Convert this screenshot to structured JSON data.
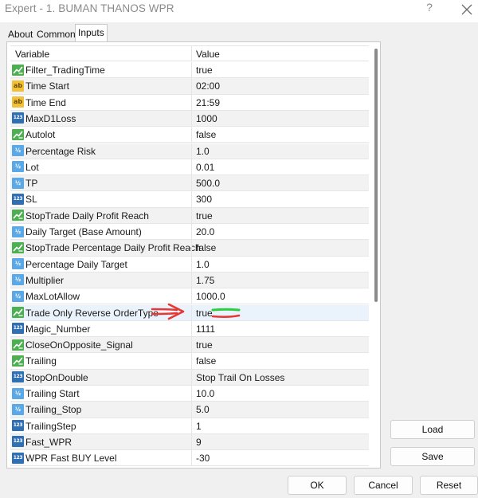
{
  "window": {
    "title": "Expert - 1. BUMAN THANOS WPR",
    "help_label": "?"
  },
  "tabs": [
    {
      "label": "About"
    },
    {
      "label": "Common"
    },
    {
      "label": "Inputs"
    }
  ],
  "grid": {
    "header": {
      "variable": "Variable",
      "value": "Value"
    },
    "rows": [
      {
        "icon": "bool-param-icon",
        "glyph": "",
        "name": "Filter_TradingTime",
        "value": "true"
      },
      {
        "icon": "string-param-icon",
        "glyph": "ab",
        "name": "Time Start",
        "value": "02:00"
      },
      {
        "icon": "string-param-icon",
        "glyph": "ab",
        "name": "Time End",
        "value": "21:59"
      },
      {
        "icon": "int-param-icon",
        "glyph": "123",
        "name": "MaxD1Loss",
        "value": "1000"
      },
      {
        "icon": "bool-param-icon",
        "glyph": "",
        "name": "Autolot",
        "value": "false"
      },
      {
        "icon": "double-param-icon",
        "glyph": "½",
        "name": "Percentage Risk",
        "value": "1.0"
      },
      {
        "icon": "double-param-icon",
        "glyph": "½",
        "name": "Lot",
        "value": "0.01"
      },
      {
        "icon": "double-param-icon",
        "glyph": "½",
        "name": "TP",
        "value": "500.0"
      },
      {
        "icon": "int-param-icon",
        "glyph": "123",
        "name": "SL",
        "value": "300"
      },
      {
        "icon": "bool-param-icon",
        "glyph": "",
        "name": "StopTrade Daily Profit Reach",
        "value": "true"
      },
      {
        "icon": "double-param-icon",
        "glyph": "½",
        "name": "Daily Target (Base Amount)",
        "value": "20.0"
      },
      {
        "icon": "bool-param-icon",
        "glyph": "",
        "name": "StopTrade Percentage Daily Profit Reach",
        "value": "false"
      },
      {
        "icon": "double-param-icon",
        "glyph": "½",
        "name": "Percentage Daily Target",
        "value": "1.0"
      },
      {
        "icon": "double-param-icon",
        "glyph": "½",
        "name": "Multiplier",
        "value": "1.75"
      },
      {
        "icon": "double-param-icon",
        "glyph": "½",
        "name": "MaxLotAllow",
        "value": "1000.0"
      },
      {
        "icon": "bool-param-icon",
        "glyph": "",
        "name": "Trade Only Reverse OrderType",
        "value": "true"
      },
      {
        "icon": "int-param-icon",
        "glyph": "123",
        "name": "Magic_Number",
        "value": "1111"
      },
      {
        "icon": "bool-param-icon",
        "glyph": "",
        "name": "CloseOnOpposite_Signal",
        "value": "true"
      },
      {
        "icon": "bool-param-icon",
        "glyph": "",
        "name": "Trailing",
        "value": "false"
      },
      {
        "icon": "int-param-icon",
        "glyph": "123",
        "name": "StopOnDouble",
        "value": "Stop Trail On Losses"
      },
      {
        "icon": "double-param-icon",
        "glyph": "½",
        "name": "Trailing Start",
        "value": "10.0"
      },
      {
        "icon": "double-param-icon",
        "glyph": "½",
        "name": "Trailing_Stop",
        "value": "5.0"
      },
      {
        "icon": "int-param-icon",
        "glyph": "123",
        "name": "TrailingStep",
        "value": "1"
      },
      {
        "icon": "int-param-icon",
        "glyph": "123",
        "name": "Fast_WPR",
        "value": "9"
      },
      {
        "icon": "int-param-icon",
        "glyph": "123",
        "name": "WPR Fast BUY Level",
        "value": "-30"
      }
    ]
  },
  "buttons": {
    "load": "Load",
    "save": "Save",
    "ok": "OK",
    "cancel": "Cancel",
    "reset": "Reset"
  },
  "colors": {
    "bool_icon": "#4caf50",
    "string_icon": "#f2c037",
    "double_icon": "#5aa9e6",
    "int_icon": "#2f6fb4",
    "annotation_arrow": "#e53935",
    "annotation_green": "#2ecc40"
  }
}
